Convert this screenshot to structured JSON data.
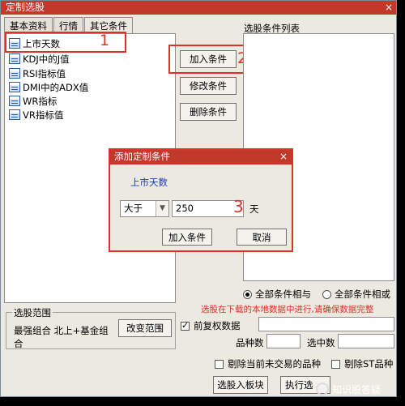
{
  "window": {
    "title": "定制选股",
    "close_glyph": "×"
  },
  "tabs": [
    {
      "label": "基本资料"
    },
    {
      "label": "行情"
    },
    {
      "label": "其它条件"
    }
  ],
  "condition_items": [
    {
      "label": "上市天数"
    },
    {
      "label": "KDJ中的J值"
    },
    {
      "label": "RSI指标值"
    },
    {
      "label": "DMI中的ADX值"
    },
    {
      "label": "WR指标"
    },
    {
      "label": "VR指标值"
    }
  ],
  "annotations": {
    "n1": "1",
    "n2": "2",
    "n3": "3"
  },
  "buttons": {
    "add": "加入条件",
    "modify": "修改条件",
    "delete": "删除条件",
    "change_range": "改变范围",
    "select_to_board": "选股入板块",
    "execute": "执行选"
  },
  "right_panel": {
    "title": "选股条件列表"
  },
  "logic": {
    "and_label": "全部条件相与",
    "or_label": "全部条件相或",
    "selected": "and"
  },
  "warning": "选股在下载的本地数据中进行,请确保数据完整",
  "options": {
    "forward_adjust": {
      "label": "前复权数据",
      "checked": true
    },
    "exclude_untraded": {
      "label": "剔除当前未交易的品种",
      "checked": false
    },
    "exclude_st": {
      "label": "剔除ST品种",
      "checked": false
    }
  },
  "stats": {
    "variety_count_label": "品种数",
    "selected_count_label": "选中数"
  },
  "range": {
    "title": "选股范围",
    "value_line1": "最强组合 北上+基金组",
    "value_line2": "合"
  },
  "sub_dialog": {
    "title": "添加定制条件",
    "close_glyph": "×",
    "heading": "上市天数",
    "operator": "大于",
    "operator_arrow": "▼",
    "value": "250",
    "unit": "天",
    "ok_label": "加入条件",
    "cancel_label": "取消"
  },
  "watermark": {
    "text": "知识股答疑"
  },
  "colors": {
    "title_bar": "#c0392b",
    "annotation": "#e0302a",
    "warning": "#e0302a",
    "heading": "#1b3fa8"
  }
}
